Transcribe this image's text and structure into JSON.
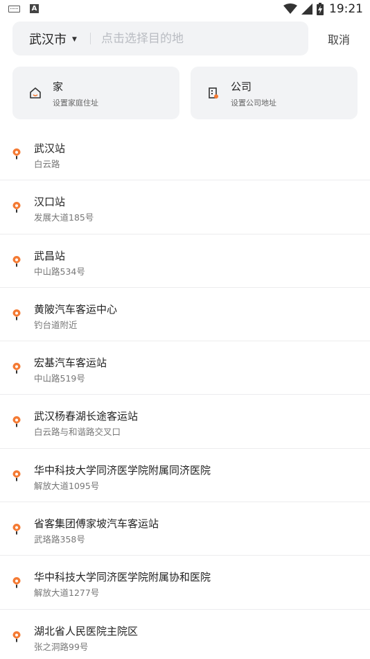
{
  "status_bar": {
    "time": "19:21",
    "left_icons": [
      "keyboard-icon",
      "font-a-icon"
    ],
    "right_icons": [
      "wifi-icon",
      "cell-signal-icon",
      "battery-charging-icon"
    ]
  },
  "search": {
    "city": "武汉市",
    "placeholder": "点击选择目的地",
    "cancel_label": "取消"
  },
  "quick": {
    "home": {
      "title": "家",
      "subtitle": "设置家庭住址",
      "icon": "home-icon"
    },
    "company": {
      "title": "公司",
      "subtitle": "设置公司地址",
      "icon": "company-building-icon"
    }
  },
  "places": [
    {
      "name": "武汉站",
      "address": "白云路"
    },
    {
      "name": "汉口站",
      "address": "发展大道185号"
    },
    {
      "name": "武昌站",
      "address": "中山路534号"
    },
    {
      "name": "黄陂汽车客运中心",
      "address": "钓台道附近"
    },
    {
      "name": "宏基汽车客运站",
      "address": "中山路519号"
    },
    {
      "name": "武汉杨春湖长途客运站",
      "address": "白云路与和谐路交叉口"
    },
    {
      "name": "华中科技大学同济医学院附属同济医院",
      "address": "解放大道1095号"
    },
    {
      "name": "省客集团傅家坡汽车客运站",
      "address": "武珞路358号"
    },
    {
      "name": "华中科技大学同济医学院附属协和医院",
      "address": "解放大道1277号"
    },
    {
      "name": "湖北省人民医院主院区",
      "address": "张之洞路99号"
    }
  ],
  "colors": {
    "accent_pin": "#f47a33",
    "card_bg": "#f2f3f5",
    "text_primary": "#222222",
    "text_secondary": "#777777"
  }
}
